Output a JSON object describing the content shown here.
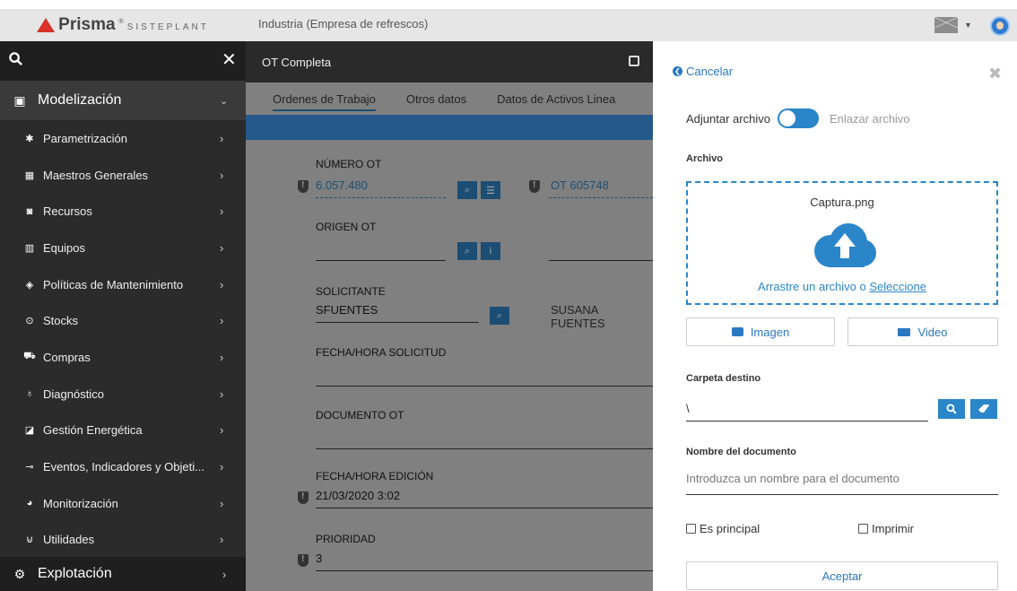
{
  "topbar": {
    "brand_name": "Prisma",
    "brand_sub": "SISTEPLANT",
    "company": "Industria (Empresa de refrescos)"
  },
  "sidebar": {
    "section_head": "Modelización",
    "items": [
      {
        "label": "Parametrización",
        "icon": "gear-icon"
      },
      {
        "label": "Maestros Generales",
        "icon": "grid-icon"
      },
      {
        "label": "Recursos",
        "icon": "resources-icon"
      },
      {
        "label": "Equipos",
        "icon": "building-icon"
      },
      {
        "label": "Políticas de Mantenimiento",
        "icon": "policy-icon"
      },
      {
        "label": "Stocks",
        "icon": "stocks-icon"
      },
      {
        "label": "Compras",
        "icon": "cart-icon"
      },
      {
        "label": "Diagnóstico",
        "icon": "stethoscope-icon"
      },
      {
        "label": "Gestión Energética",
        "icon": "energy-icon"
      },
      {
        "label": "Eventos, Indicadores y Objeti...",
        "icon": "events-icon"
      },
      {
        "label": "Monitorización",
        "icon": "gauge-icon"
      },
      {
        "label": "Utilidades",
        "icon": "magnet-icon"
      }
    ],
    "footer": "Explotación"
  },
  "main": {
    "title": "OT Completa",
    "tabs": [
      "Ordenes de Trabajo",
      "Otros datos",
      "Datos de Activos Linea"
    ],
    "fields": {
      "numero_label": "NÚMERO OT",
      "numero_value": "6.057.480",
      "numero_ref": "OT 605748",
      "origen_label": "ORIGEN OT",
      "solicitante_label": "SOLICITANTE",
      "solicitante_value": "SFUENTES",
      "solicitante_name": "SUSANA FUENTES",
      "fecha_sol_label": "FECHA/HORA SOLICITUD",
      "documento_label": "DOCUMENTO OT",
      "fecha_ed_label": "FECHA/HORA EDICIÓN",
      "fecha_ed_value": "21/03/2020 3:02",
      "prioridad_label": "PRIORIDAD",
      "prioridad_value": "3"
    }
  },
  "panel": {
    "cancel": "Cancelar",
    "attach_label": "Adjuntar archivo",
    "link_label": "Enlazar archivo",
    "archivo_label": "Archivo",
    "filename": "Captura.png",
    "drop_text": "Arrastre un archivo o",
    "drop_link": "Seleccione",
    "image_btn": "Imagen",
    "video_btn": "Video",
    "folder_label": "Carpeta destino",
    "folder_value": "\\",
    "docname_label": "Nombre del documento",
    "docname_placeholder": "Introduzca un nombre para el documento",
    "principal": "Es principal",
    "imprimir": "Imprimir",
    "accept": "Aceptar"
  }
}
